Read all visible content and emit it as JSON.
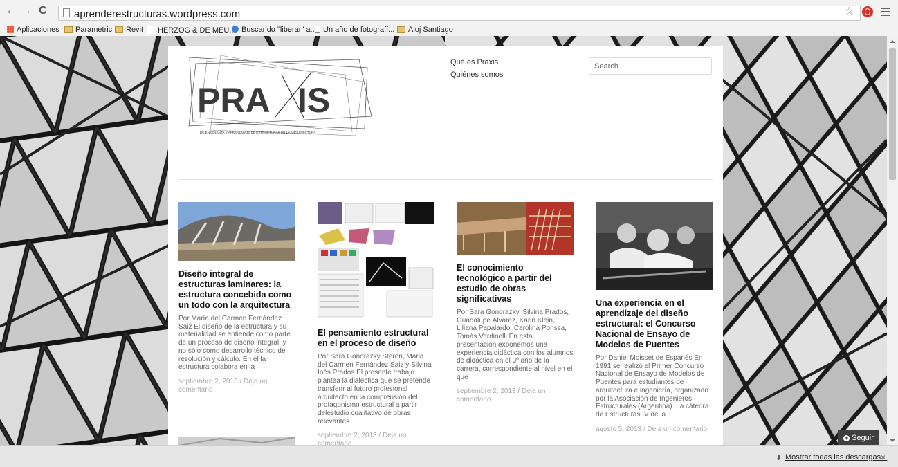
{
  "browser": {
    "url": "aprenderestructuras.wordpress.com",
    "nav": {
      "back": "←",
      "forward": "→",
      "reload": "C"
    },
    "star": "☆",
    "bookmarks": [
      {
        "label": "Aplicaciones",
        "icon": "apps-icon"
      },
      {
        "label": "Parametric",
        "icon": "folder-icon"
      },
      {
        "label": "Revit",
        "icon": "folder-icon"
      },
      {
        "label": "HERZOG & DE MEU...",
        "icon": "blank-page-icon"
      },
      {
        "label": "Buscando \"liberar\" a...",
        "icon": "globe-icon"
      },
      {
        "label": "Un año de fotografí...",
        "icon": "page-icon"
      },
      {
        "label": "Aloj Santiago",
        "icon": "folder-icon"
      }
    ]
  },
  "site": {
    "logo": {
      "text": "PRAXIS",
      "subtitle": "DE ENSEÑANZA Y APRENDIZAJE DE ESTRUCTURAS EN LA ARQUITECTURA"
    },
    "nav": [
      "Qué es Praxis",
      "Quiénes somos"
    ],
    "search_placeholder": "Search",
    "posts": [
      {
        "title": "Diseño integral de estructuras laminares: la estructura concebida como un todo con la arquitectura",
        "excerpt": "Por María del Carmen Fernández Saiz El diseño de la estructura y su materialidad se entiende como parte de un proceso de diseño integral, y no sólo como desarrollo técnico de resolución y cálculo. En él la estructura colabora en la",
        "date": "septiembre 2, 2013",
        "sep": " / ",
        "comment": "Deja un comentario"
      },
      {
        "title": "El pensamiento estructural en el proceso de diseño",
        "excerpt": "Por Sara Gonorazky Steren, Maria del Carmen Fernández Saiz y Silvina Inés Prados El presente trabajo plantea la dialéctica que se pretende transferir al futuro profesional arquitecto en la comprensión del protagonismo estructural a partir delestudio cualitativo de obras relevantes",
        "date": "septiembre 2, 2013",
        "sep": " / ",
        "comment": "Deja un comentario"
      },
      {
        "title": "El conocimiento tecnológico a partir del estudio de obras significativas",
        "excerpt": "Por Sara Gonorazky, Silvina Prados, Guadalupe Álvarez, Karin Klein, Liliana Papalardo, Carolina Ponssa, Tomás Verdinelli En esta presentación exponemos una experiencia didáctica con los alumnos de didáctica en el 3º año de la carrera,  correspondiente al nivel en el que",
        "date": "septiembre 2, 2013",
        "sep": " / ",
        "comment": "Deja un comentario"
      },
      {
        "title": "Una experiencia en el aprendizaje del diseño estructural: el Concurso Nacional de Ensayo de Modelos de Puentes",
        "excerpt": "Por Daniel Moisset de Espanés En 1991 se realizó el Primer Concurso Nacional de Ensayo de Modelos de Puentes para estudiantes de arquitectura e ingeniería, organizado por la Asociación de Ingenieros Estructurales (Argentina). La cátedra de Estructuras IV de la",
        "date": "agosto 5, 2013",
        "sep": " / ",
        "comment": "Deja un comentario"
      }
    ],
    "follow_label": "Seguir"
  },
  "downloads": {
    "link": "Mostrar todas las descargas...",
    "close": "×"
  },
  "colors": {
    "accent": "#d93025",
    "follow_bg": "#404040",
    "meta": "#aaaaaa"
  }
}
